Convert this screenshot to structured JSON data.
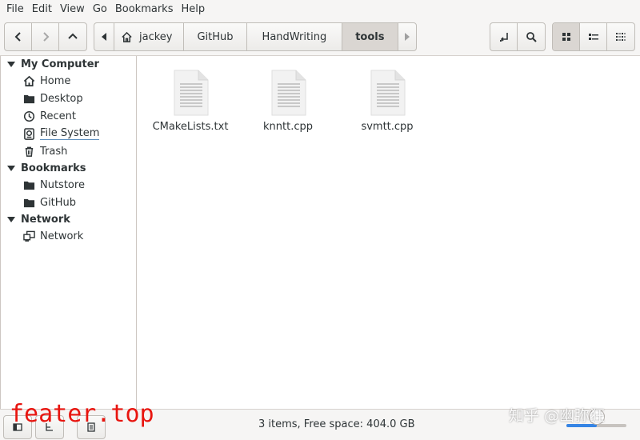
{
  "menubar": {
    "items": [
      "File",
      "Edit",
      "View",
      "Go",
      "Bookmarks",
      "Help"
    ]
  },
  "toolbar": {
    "breadcrumbs": [
      "jackey",
      "GitHub",
      "HandWriting",
      "tools"
    ],
    "current_crumb": "tools"
  },
  "sidebar": {
    "sections": [
      {
        "title": "My Computer",
        "items": [
          {
            "label": "Home",
            "icon": "home-icon"
          },
          {
            "label": "Desktop",
            "icon": "folder-icon"
          },
          {
            "label": "Recent",
            "icon": "clock-icon"
          },
          {
            "label": "File System",
            "icon": "drive-icon"
          },
          {
            "label": "Trash",
            "icon": "trash-icon"
          }
        ]
      },
      {
        "title": "Bookmarks",
        "items": [
          {
            "label": "Nutstore",
            "icon": "folder-icon"
          },
          {
            "label": "GitHub",
            "icon": "folder-icon"
          }
        ]
      },
      {
        "title": "Network",
        "items": [
          {
            "label": "Network",
            "icon": "network-icon"
          }
        ]
      }
    ]
  },
  "files": [
    {
      "name": "CMakeLists.txt",
      "icon": "text-file-icon"
    },
    {
      "name": "knntt.cpp",
      "icon": "text-file-icon"
    },
    {
      "name": "svmtt.cpp",
      "icon": "text-file-icon"
    }
  ],
  "status": {
    "text": "3 items, Free space: 404.0 GB",
    "zoom_level": 0.5
  },
  "watermarks": {
    "left": "feater.top",
    "right": "知乎 @幽弥狂"
  },
  "colors": {
    "accent": "#3584e4",
    "watermark_red": "#e8150f"
  }
}
